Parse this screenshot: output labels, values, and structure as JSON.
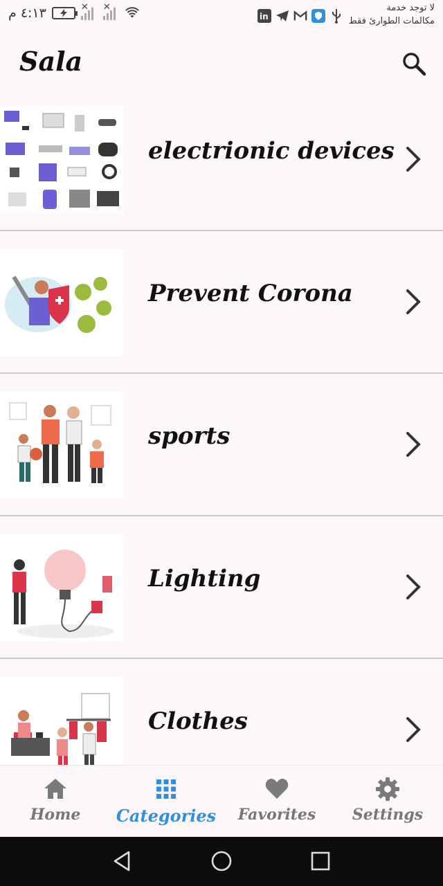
{
  "status_bar": {
    "time": "٤:١٣ م",
    "carrier_line1": "لا توجد خدمة",
    "carrier_line2": "مكالمات الطوارئ فقط",
    "icons": [
      "linkedin-icon",
      "telegram-icon",
      "gmail-icon",
      "shield-icon",
      "usb-icon",
      "wifi-icon",
      "battery-charging-icon",
      "signal-icon"
    ]
  },
  "app_bar": {
    "title": "Sala",
    "search_icon": "search-icon"
  },
  "categories": [
    {
      "label": "electrionic devices",
      "image": "electronic-devices-illustration",
      "icon": "chevron-right-icon"
    },
    {
      "label": "Prevent Corona",
      "image": "prevent-corona-illustration",
      "icon": "chevron-right-icon"
    },
    {
      "label": "sports",
      "image": "sports-family-illustration",
      "icon": "chevron-right-icon"
    },
    {
      "label": "Lighting",
      "image": "lighting-bulb-illustration",
      "icon": "chevron-right-icon"
    },
    {
      "label": "Clothes",
      "image": "clothes-shop-illustration",
      "icon": "chevron-right-icon"
    }
  ],
  "bottom_nav": {
    "items": [
      {
        "label": "Home",
        "icon": "home-icon",
        "active": false
      },
      {
        "label": "Categories",
        "icon": "grid-icon",
        "active": true
      },
      {
        "label": "Favorites",
        "icon": "heart-icon",
        "active": false
      },
      {
        "label": "Settings",
        "icon": "gear-icon",
        "active": false
      }
    ],
    "active_color": "#2f8fe0",
    "inactive_color": "#777777"
  },
  "system_nav": {
    "buttons": [
      "back-icon",
      "home-circle-icon",
      "recents-icon"
    ]
  },
  "colors": {
    "background": "#fdf6fb",
    "divider": "#c8c8c8",
    "text": "#111111"
  }
}
